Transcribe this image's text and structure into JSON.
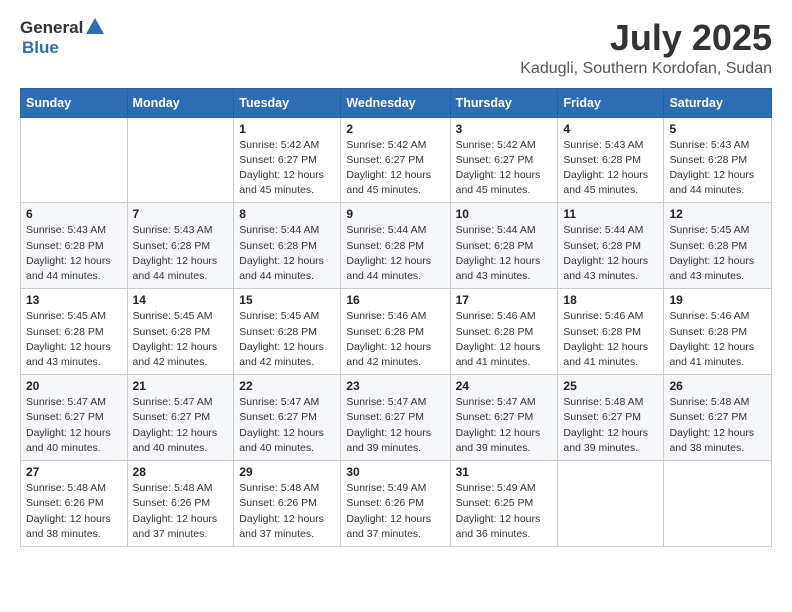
{
  "header": {
    "logo_general": "General",
    "logo_blue": "Blue",
    "title": "July 2025",
    "subtitle": "Kadugli, Southern Kordofan, Sudan"
  },
  "days_of_week": [
    "Sunday",
    "Monday",
    "Tuesday",
    "Wednesday",
    "Thursday",
    "Friday",
    "Saturday"
  ],
  "weeks": [
    [
      {
        "day": "",
        "info": ""
      },
      {
        "day": "",
        "info": ""
      },
      {
        "day": "1",
        "info": "Sunrise: 5:42 AM\nSunset: 6:27 PM\nDaylight: 12 hours and 45 minutes."
      },
      {
        "day": "2",
        "info": "Sunrise: 5:42 AM\nSunset: 6:27 PM\nDaylight: 12 hours and 45 minutes."
      },
      {
        "day": "3",
        "info": "Sunrise: 5:42 AM\nSunset: 6:27 PM\nDaylight: 12 hours and 45 minutes."
      },
      {
        "day": "4",
        "info": "Sunrise: 5:43 AM\nSunset: 6:28 PM\nDaylight: 12 hours and 45 minutes."
      },
      {
        "day": "5",
        "info": "Sunrise: 5:43 AM\nSunset: 6:28 PM\nDaylight: 12 hours and 44 minutes."
      }
    ],
    [
      {
        "day": "6",
        "info": "Sunrise: 5:43 AM\nSunset: 6:28 PM\nDaylight: 12 hours and 44 minutes."
      },
      {
        "day": "7",
        "info": "Sunrise: 5:43 AM\nSunset: 6:28 PM\nDaylight: 12 hours and 44 minutes."
      },
      {
        "day": "8",
        "info": "Sunrise: 5:44 AM\nSunset: 6:28 PM\nDaylight: 12 hours and 44 minutes."
      },
      {
        "day": "9",
        "info": "Sunrise: 5:44 AM\nSunset: 6:28 PM\nDaylight: 12 hours and 44 minutes."
      },
      {
        "day": "10",
        "info": "Sunrise: 5:44 AM\nSunset: 6:28 PM\nDaylight: 12 hours and 43 minutes."
      },
      {
        "day": "11",
        "info": "Sunrise: 5:44 AM\nSunset: 6:28 PM\nDaylight: 12 hours and 43 minutes."
      },
      {
        "day": "12",
        "info": "Sunrise: 5:45 AM\nSunset: 6:28 PM\nDaylight: 12 hours and 43 minutes."
      }
    ],
    [
      {
        "day": "13",
        "info": "Sunrise: 5:45 AM\nSunset: 6:28 PM\nDaylight: 12 hours and 43 minutes."
      },
      {
        "day": "14",
        "info": "Sunrise: 5:45 AM\nSunset: 6:28 PM\nDaylight: 12 hours and 42 minutes."
      },
      {
        "day": "15",
        "info": "Sunrise: 5:45 AM\nSunset: 6:28 PM\nDaylight: 12 hours and 42 minutes."
      },
      {
        "day": "16",
        "info": "Sunrise: 5:46 AM\nSunset: 6:28 PM\nDaylight: 12 hours and 42 minutes."
      },
      {
        "day": "17",
        "info": "Sunrise: 5:46 AM\nSunset: 6:28 PM\nDaylight: 12 hours and 41 minutes."
      },
      {
        "day": "18",
        "info": "Sunrise: 5:46 AM\nSunset: 6:28 PM\nDaylight: 12 hours and 41 minutes."
      },
      {
        "day": "19",
        "info": "Sunrise: 5:46 AM\nSunset: 6:28 PM\nDaylight: 12 hours and 41 minutes."
      }
    ],
    [
      {
        "day": "20",
        "info": "Sunrise: 5:47 AM\nSunset: 6:27 PM\nDaylight: 12 hours and 40 minutes."
      },
      {
        "day": "21",
        "info": "Sunrise: 5:47 AM\nSunset: 6:27 PM\nDaylight: 12 hours and 40 minutes."
      },
      {
        "day": "22",
        "info": "Sunrise: 5:47 AM\nSunset: 6:27 PM\nDaylight: 12 hours and 40 minutes."
      },
      {
        "day": "23",
        "info": "Sunrise: 5:47 AM\nSunset: 6:27 PM\nDaylight: 12 hours and 39 minutes."
      },
      {
        "day": "24",
        "info": "Sunrise: 5:47 AM\nSunset: 6:27 PM\nDaylight: 12 hours and 39 minutes."
      },
      {
        "day": "25",
        "info": "Sunrise: 5:48 AM\nSunset: 6:27 PM\nDaylight: 12 hours and 39 minutes."
      },
      {
        "day": "26",
        "info": "Sunrise: 5:48 AM\nSunset: 6:27 PM\nDaylight: 12 hours and 38 minutes."
      }
    ],
    [
      {
        "day": "27",
        "info": "Sunrise: 5:48 AM\nSunset: 6:26 PM\nDaylight: 12 hours and 38 minutes."
      },
      {
        "day": "28",
        "info": "Sunrise: 5:48 AM\nSunset: 6:26 PM\nDaylight: 12 hours and 37 minutes."
      },
      {
        "day": "29",
        "info": "Sunrise: 5:48 AM\nSunset: 6:26 PM\nDaylight: 12 hours and 37 minutes."
      },
      {
        "day": "30",
        "info": "Sunrise: 5:49 AM\nSunset: 6:26 PM\nDaylight: 12 hours and 37 minutes."
      },
      {
        "day": "31",
        "info": "Sunrise: 5:49 AM\nSunset: 6:25 PM\nDaylight: 12 hours and 36 minutes."
      },
      {
        "day": "",
        "info": ""
      },
      {
        "day": "",
        "info": ""
      }
    ]
  ]
}
